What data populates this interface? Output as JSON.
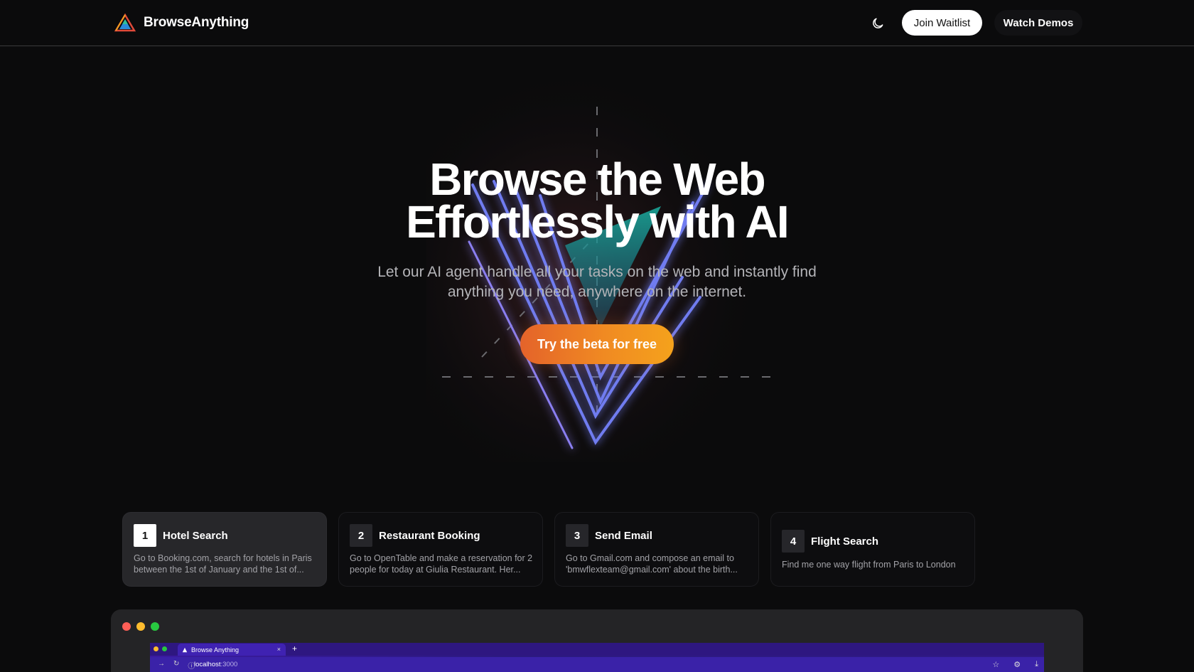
{
  "header": {
    "brand_name": "BrowseAnything",
    "logo_icon": "prism-triangle-icon",
    "theme_icon": "moon-icon",
    "join_waitlist_label": "Join Waitlist",
    "watch_demos_label": "Watch Demos"
  },
  "hero": {
    "title_line1": "Browse the Web",
    "title_line2": "Effortlessly with AI",
    "subtitle_line1": "Let our AI agent handle all your tasks on the web and instantly find",
    "subtitle_line2": "anything you need, anywhere on the internet.",
    "cta_label": "Try the beta for free",
    "cta_color_start": "#e4632a",
    "cta_color_end": "#f5a21c"
  },
  "tasks": [
    {
      "number": "1",
      "title": "Hotel Search",
      "description": "Go to Booking.com, search for hotels in Paris between the 1st of January and the 1st of...",
      "active": true
    },
    {
      "number": "2",
      "title": "Restaurant Booking",
      "description": "Go to OpenTable and make a reservation for 2 people for today at Giulia Restaurant. Her...",
      "active": false
    },
    {
      "number": "3",
      "title": "Send Email",
      "description": "Go to Gmail.com and compose an email to 'bmwflexteam@gmail.com' about the birth...",
      "active": false
    },
    {
      "number": "4",
      "title": "Flight Search",
      "description": "Find me one way flight from Paris to London",
      "active": false
    }
  ],
  "demo_window": {
    "tab_title": "Browse Anything",
    "tab_close": "×",
    "new_tab": "+",
    "url_host": "localhost",
    "url_port": ":3000",
    "window_dot_colors": [
      "#ff5f57",
      "#febc2e",
      "#28c840"
    ]
  }
}
